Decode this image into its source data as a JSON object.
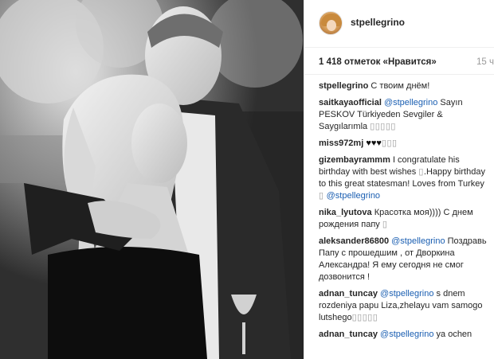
{
  "post": {
    "username": "stpellegrino",
    "likes": "1 418 отметок «Нравится»",
    "time": "15 ч"
  },
  "comments": [
    {
      "user": "stpellegrino",
      "parts": [
        {
          "text": "С твоим днём!",
          "type": "text"
        }
      ]
    },
    {
      "user": "saitkayaofficial",
      "parts": [
        {
          "text": "@stpellegrino",
          "type": "mention"
        },
        {
          "text": " Sayın PESKOV Türkiyeden Sevgiler & Saygılarımla ",
          "type": "text"
        },
        {
          "text": "▯▯▯▯▯",
          "type": "glyph"
        }
      ]
    },
    {
      "user": "miss972mj",
      "parts": [
        {
          "text": "♥♥♥",
          "type": "hearts"
        },
        {
          "text": "▯▯▯",
          "type": "glyph"
        }
      ]
    },
    {
      "user": "gizembayrammm",
      "parts": [
        {
          "text": "I congratulate his birthday with best wishes ",
          "type": "text"
        },
        {
          "text": "▯",
          "type": "glyph"
        },
        {
          "text": ".Happy birthday to this great statesman! Loves from Turkey ",
          "type": "text"
        },
        {
          "text": "▯",
          "type": "glyph"
        },
        {
          "text": " ",
          "type": "text"
        },
        {
          "text": "@stpellegrino",
          "type": "mention"
        }
      ]
    },
    {
      "user": "nika_lyutova",
      "parts": [
        {
          "text": "Красотка моя)))) С днем рождения папу ",
          "type": "text"
        },
        {
          "text": "▯",
          "type": "glyph"
        }
      ]
    },
    {
      "user": "aleksander86800",
      "parts": [
        {
          "text": "@stpellegrino",
          "type": "mention"
        },
        {
          "text": " Поздравь Папу с прошедшим , от Дворкина Александра! Я ему сегодня не смог дозвонится !",
          "type": "text"
        }
      ]
    },
    {
      "user": "adnan_tuncay",
      "parts": [
        {
          "text": "@stpellegrino",
          "type": "mention"
        },
        {
          "text": " s dnem rozdeniya papu Liza,zhelayu vam samogo lutshego",
          "type": "text"
        },
        {
          "text": "▯▯▯▯▯",
          "type": "glyph"
        }
      ]
    },
    {
      "user": "adnan_tuncay",
      "parts": [
        {
          "text": "@stpellegrino",
          "type": "mention"
        },
        {
          "text": " ya ochen",
          "type": "text"
        }
      ]
    }
  ],
  "colors": {
    "mention": "#1b5fb2",
    "text": "#262626",
    "muted": "#999999"
  }
}
